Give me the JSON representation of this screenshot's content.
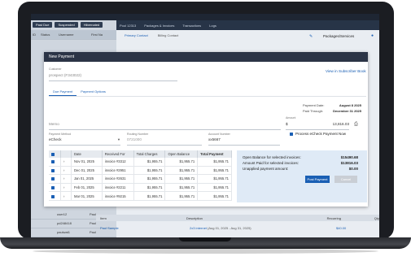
{
  "app": {
    "top_tabs": [
      "Pool 12313",
      "Packages & Invoices",
      "Transactions",
      "Logs"
    ],
    "left_buttons": [
      "Past Due",
      "Suspended",
      "Hibernated"
    ],
    "left_columns": [
      "ID",
      "Status",
      "Username",
      "First Na"
    ],
    "left_rows": [
      {
        "status": "",
        "username": "user12",
        "first": "Paul"
      },
      {
        "status": "",
        "username": "pd248418",
        "first": "Paul"
      },
      {
        "status": "",
        "username": "paulwat1",
        "first": "Paul"
      }
    ],
    "right_tabs": [
      "Primary Contact",
      "Billing Contact"
    ],
    "packages_label": "Packages/Services",
    "bottom_headers": [
      "Item",
      "Description",
      "Recurring",
      "Qty"
    ],
    "bottom_rows": [
      {
        "item": "Paul Sample",
        "description": "2x3 internet",
        "date": "(Aug 01, 2025 - Aug 31, 2025)",
        "amount": "$40.00"
      }
    ]
  },
  "modal": {
    "title": "New Payment",
    "customer_label": "Customer",
    "customer_value": "prospect (F343022)",
    "view_link": "View in Subscriber Book",
    "tabs": [
      "Due Payment",
      "Payment Options"
    ],
    "payment_date_label": "Payment Date:",
    "payment_date_value": "August 8 2025",
    "paid_through_label": "Paid Through:",
    "paid_through_value": "December 31 2025",
    "memo_placeholder": "Memo",
    "amount_label": "Amount",
    "amount_currency": "$",
    "amount_value": "13,816.03",
    "payment_method_label": "Payment Method",
    "payment_method_value": "eCheck",
    "routing_label": "Routing Number",
    "routing_value": "0721000",
    "account_label": "Account Number",
    "account_value": "xx5667",
    "process_label": "Process eCheck Payment Now",
    "table": {
      "headers": [
        "Date",
        "Received For",
        "Total Charges",
        "Open Balance",
        "Total Payment"
      ],
      "rows": [
        {
          "date": "Nov 01, 2025",
          "for": "invoice #3312",
          "charges": "$1,955.71",
          "open": "$1,955.71",
          "payment": "$1,955.71"
        },
        {
          "date": "Dec 01, 2025",
          "for": "invoice #2951",
          "charges": "$1,955.71",
          "open": "$1,955.71",
          "payment": "$1,955.71"
        },
        {
          "date": "Jan 01, 2025",
          "for": "invoice #2631",
          "charges": "$1,955.71",
          "open": "$1,955.71",
          "payment": "$1,955.71"
        },
        {
          "date": "Feb 01, 2025",
          "for": "invoice #2211",
          "charges": "$1,955.71",
          "open": "$1,955.71",
          "payment": "$1,955.71"
        },
        {
          "date": "Mar 01, 2025",
          "for": "invoice #9215",
          "charges": "$1,955.71",
          "open": "$1,955.71",
          "payment": "$1,955.71"
        }
      ]
    },
    "summary": {
      "open_label": "Open Balance for selected invoices:",
      "open_value": "$15490.68",
      "paid_label": "Amount Paid for selected invoices:",
      "paid_value": "$13816.03",
      "unapplied_label": "Unapplied payment amount:",
      "unapplied_value": "$0.00",
      "post_button": "Post Payment",
      "cancel_button": "Cancel"
    }
  }
}
